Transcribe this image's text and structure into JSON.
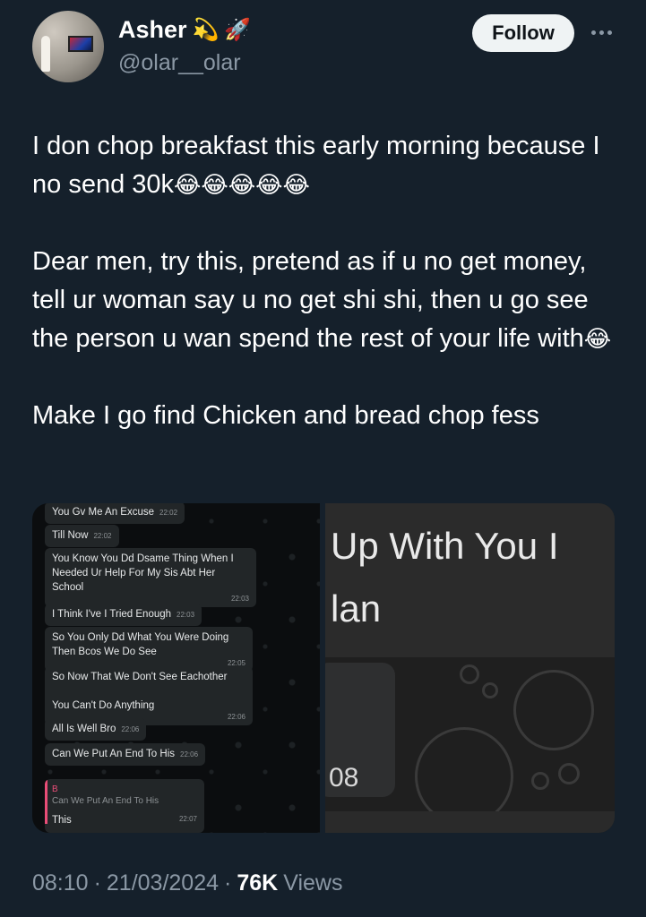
{
  "author": {
    "name": "Asher",
    "emoji": [
      "💫",
      "🚀"
    ],
    "handle": "@olar__olar",
    "avatar_icon": "avatar-photo"
  },
  "actions": {
    "follow_label": "Follow",
    "more_icon": "more-dots-icon"
  },
  "tweet": {
    "line1": "I don chop breakfast this early morning because I no send 30k",
    "line1_emoji": "😂😂😂😂😂",
    "line2": "Dear men, try this, pretend as if u no get money, tell ur woman say u no get shi shi, then u go see the person u wan spend the rest of your life with",
    "line2_emoji": "😂",
    "line3": "Make I go find Chicken and bread chop fess"
  },
  "media": {
    "left_chat": [
      {
        "text": "You Gv Me An Excuse",
        "time": "22:02"
      },
      {
        "text": "Till Now",
        "time": "22:02"
      },
      {
        "text": "You Know You Dd Dsame Thing When I Needed Ur Help For My Sis Abt Her School",
        "time": "22:03"
      },
      {
        "text": "I Think I've I Tried Enough",
        "time": "22:03"
      },
      {
        "text": "So You Only Dd What You Were Doing Then Bcos We Do See",
        "time": "22:05"
      },
      {
        "text": "So Now That We Don't See Eachother\n\nYou Can't Do Anything",
        "time": "22:06"
      },
      {
        "text": "All Is Well Bro",
        "time": "22:06"
      },
      {
        "text": "Can We Put An End To His",
        "time": "22:06"
      }
    ],
    "quoted": {
      "sender": "B",
      "text": "Can We Put An End To His",
      "reply": "This",
      "time": "22:07"
    },
    "right_text_1": "Up With You I",
    "right_text_2": "lan",
    "right_number": "08"
  },
  "meta": {
    "time": "08:10",
    "date": "21/03/2024",
    "views_count": "76K",
    "views_label": "Views",
    "sep": "·"
  }
}
